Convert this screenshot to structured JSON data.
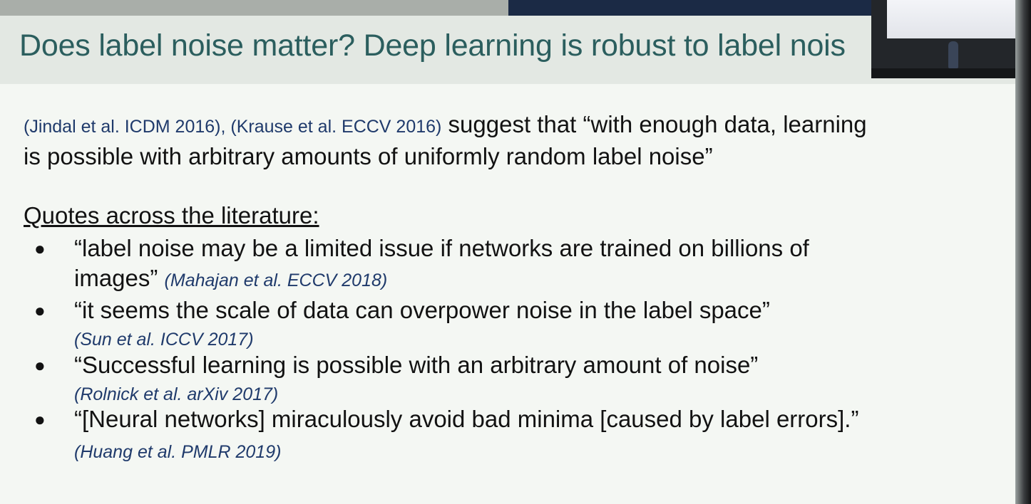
{
  "slide": {
    "title": "Does label noise matter? Deep learning is robust to label nois",
    "intro_citations": "(Jindal et al. ICDM 2016), (Krause et al. ECCV 2016)",
    "intro_text_line1": " suggest that “with enough data, learning",
    "intro_text_line2": "is possible with arbitrary amounts of uniformly random label noise”",
    "quotes_heading": "Quotes across the literature:",
    "bullets": [
      {
        "line1": "“label noise may be a limited issue if networks are trained on billions of",
        "line2": "images”",
        "citation": "(Mahajan et al. ECCV 2018)"
      },
      {
        "line1": "“it seems the scale of data can overpower noise in the label space”",
        "citation": "(Sun et al. ICCV 2017)"
      },
      {
        "line1": "“Successful learning is possible with an arbitrary amount of noise”",
        "citation": "(Rolnick et al. arXiv 2017)"
      },
      {
        "line1": "“[Neural networks] miraculously avoid bad minima [caused by label errors].”",
        "citation": "(Huang et al. PMLR 2019)"
      }
    ],
    "bullet_symbol": "●"
  },
  "colors": {
    "title": "#2b5e5e",
    "citation": "#1f3a6b",
    "body_text": "#121212",
    "background": "#f4f7f3"
  }
}
